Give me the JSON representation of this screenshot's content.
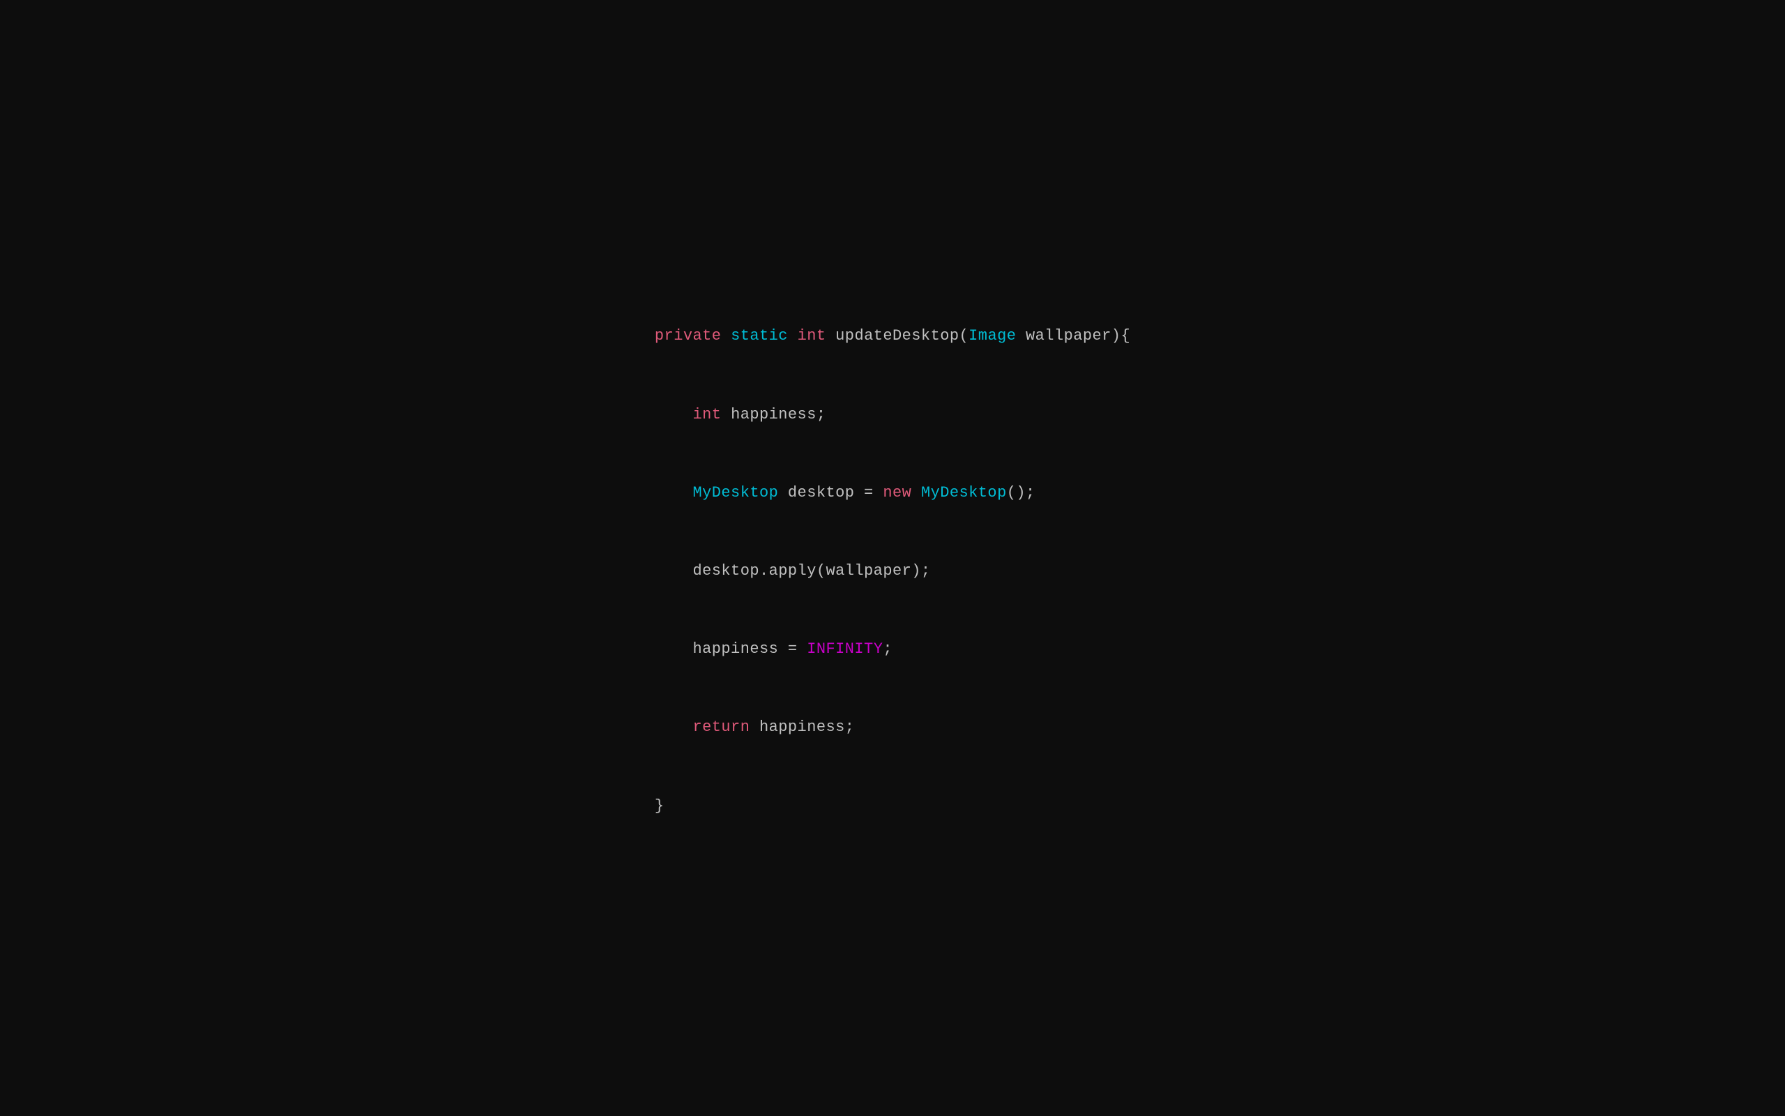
{
  "code": {
    "line1": {
      "private": "private",
      "static": "static",
      "int": "int",
      "rest": " updateDesktop(",
      "Image": "Image",
      "rest2": " wallpaper){"
    },
    "line2": {
      "int": "int",
      "rest": " happiness;"
    },
    "line3": {
      "MyDesktop": "MyDesktop",
      "rest": " desktop = ",
      "new": "new",
      "rest2": " ",
      "MyDesktop2": "MyDesktop",
      "rest3": "();"
    },
    "line4": {
      "text": "desktop.apply(wallpaper);"
    },
    "line5": {
      "text1": "happiness = ",
      "INFINITY": "INFINITY",
      "text2": ";"
    },
    "line6": {
      "return": "return",
      "rest": " happiness;"
    },
    "line7": {
      "text": "}"
    }
  }
}
